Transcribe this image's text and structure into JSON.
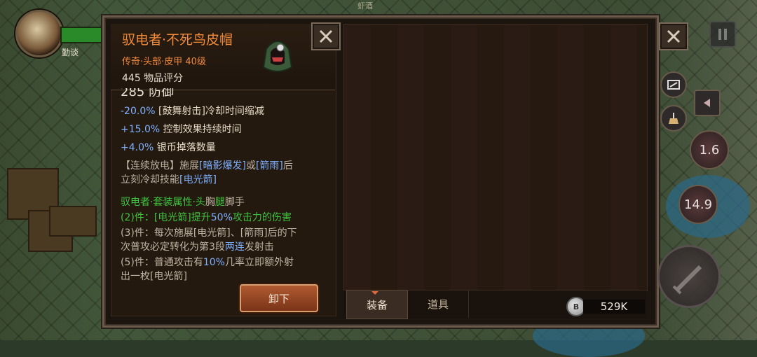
{
  "hud": {
    "hero_name": "勤谈",
    "map_name": "虾酒"
  },
  "item": {
    "title": "驭电者·不死鸟皮帽",
    "subtitle": "传奇·头部·皮甲 40级",
    "score": "445 物品评分",
    "icon": "hooded-hat-icon",
    "stats_cut": "285 防御",
    "mod1_value": "-20.0%",
    "mod1_text": "[鼓舞射击]冷却时间缩减",
    "mod2_value": "+15.0%",
    "mod2_text": "控制效果持续时间",
    "mod3_value": "+4.0%",
    "mod3_text": "银币掉落数量",
    "effect_line1_a": "【连续放电】施展",
    "effect_line1_b": "[暗影爆发]",
    "effect_line1_c": "或",
    "effect_line1_d": "[箭雨]",
    "effect_line1_e": "后",
    "effect_line2_a": "立刻冷却技能",
    "effect_line2_b": "[电光箭]",
    "set_label": "驭电者·套装属性·头",
    "set_parts": [
      "胸",
      "腿",
      "脚",
      "手"
    ],
    "set2_a": "(2)件：[电光箭]提升",
    "set2_b": "50%",
    "set2_c": "攻击力的伤害",
    "set3_l1": "(3)件：每次施展[电光箭]、[箭雨]后的下",
    "set3_l2a": "次普攻必定转化为第3段",
    "set3_l2b": "两连",
    "set3_l2c": "发射击",
    "set5_l1a": "(5)件：普通攻击有",
    "set5_l1b": "10%",
    "set5_l1c": "几率立即额外射",
    "set5_l2": "出一枚[电光箭]",
    "unequip_label": "卸下"
  },
  "inventory": {
    "tabs": [
      {
        "label": "装备",
        "active": true
      },
      {
        "label": "道具",
        "active": false
      }
    ],
    "coin_glyph": "B",
    "money": "529K"
  },
  "skills": {
    "cd1": "1.6",
    "cd2": "14.9"
  },
  "colors": {
    "legendary": "#f08a3a",
    "highlight_blue": "#7fb0ff",
    "set_green": "#3ec43e"
  }
}
